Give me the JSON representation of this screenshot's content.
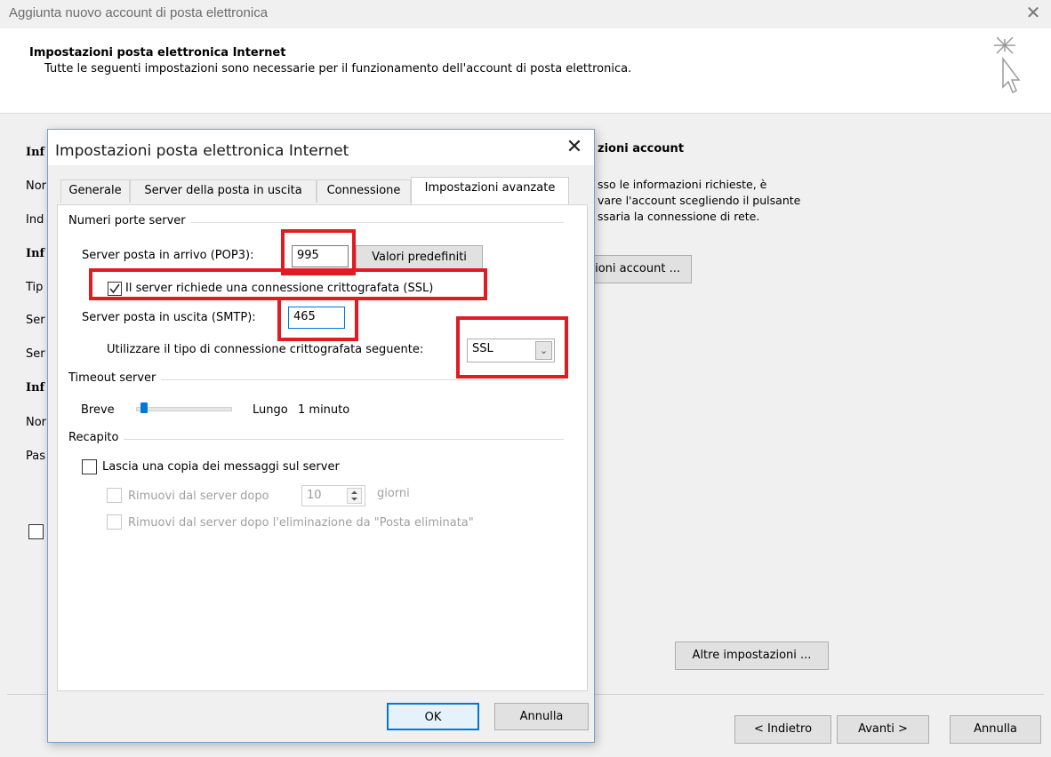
{
  "outer": {
    "window_title": "Aggiunta nuovo account di posta elettronica",
    "heading": "Impostazioni posta elettronica Internet",
    "description": "Tutte le seguenti impostazioni sono necessarie per il funzionamento dell'account di posta elettronica.",
    "left_truncated": [
      "Inf",
      "Nor",
      "Ind",
      "Inf",
      "Tip",
      "Ser",
      "Ser",
      "Inf",
      "Nor",
      "Pas"
    ],
    "right_heading": "zioni account",
    "right_text": [
      "sso le informazioni richieste, è",
      "vare l'account scegliendo il pulsante",
      "ssaria la connessione di rete."
    ],
    "right_button": "zioni account ...",
    "more_settings_button": "Altre impostazioni ...",
    "back_button": "< Indietro",
    "next_button": "Avanti >",
    "cancel_button": "Annulla"
  },
  "dialog": {
    "title": "Impostazioni posta elettronica Internet",
    "tabs": [
      "Generale",
      "Server della posta in uscita",
      "Connessione",
      "Impostazioni avanzate"
    ],
    "active_tab": "Impostazioni avanzate",
    "ports_section": "Numeri porte server",
    "incoming_label": "Server posta in arrivo (POP3):",
    "incoming_value": "995",
    "defaults_button": "Valori predefiniti",
    "ssl_checkbox_label": "Il server richiede una connessione crittografata (SSL)",
    "ssl_checked": true,
    "outgoing_label": "Server posta in uscita (SMTP):",
    "outgoing_value": "465",
    "encryption_label": "Utilizzare il tipo di connessione crittografata seguente:",
    "encryption_value": "SSL",
    "timeout_section": "Timeout server",
    "timeout_short": "Breve",
    "timeout_long": "Lungo",
    "timeout_value": "1 minuto",
    "timeout_slider_fraction": 0.05,
    "delivery_section": "Recapito",
    "leave_copy_label": "Lascia una copia dei messaggi sul server",
    "remove_after_label": "Rimuovi dal server dopo",
    "remove_days_value": "10",
    "days_label": "giorni",
    "remove_deleted_label": "Rimuovi dal server dopo l'eliminazione da \"Posta eliminata\"",
    "ok_button": "OK",
    "cancel_button": "Annulla"
  },
  "colors": {
    "highlight": "#e11b22",
    "focus_border": "#0078d7",
    "slider_thumb": "#0078d7"
  }
}
